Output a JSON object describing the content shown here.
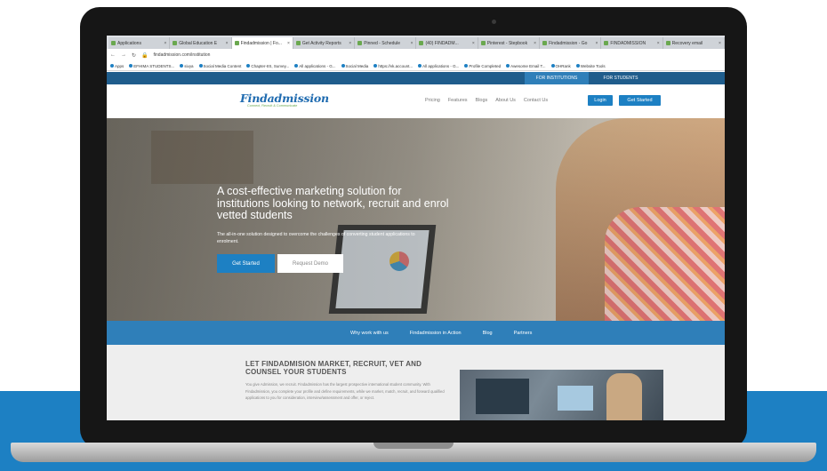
{
  "browser": {
    "tabs": [
      {
        "label": "Applications"
      },
      {
        "label": "Global Education E"
      },
      {
        "label": "Findadmission | Fo..."
      },
      {
        "label": "Get Activity Reports"
      },
      {
        "label": "Pinned - Schedule"
      },
      {
        "label": "(40) FINDADM..."
      },
      {
        "label": "Pinterest - Stepbook"
      },
      {
        "label": "Findadmission - Go"
      },
      {
        "label": "FINDADMISSION"
      },
      {
        "label": "Recovery email"
      }
    ],
    "url": "findadmission.com/institution",
    "bookmarks": [
      "Apps",
      "EFHIMA STUDENTS...",
      "sivya",
      "Social Media Content",
      "Chapter-IIS, Survey...",
      "All applications - G...",
      "Social Media",
      "https://vk.account...",
      "All applications - G...",
      "Profile Completed",
      "Awesome Email T...",
      "OHRank",
      "Website Tools"
    ]
  },
  "site": {
    "switch_institution": "FOR INSTITUTIONS",
    "switch_student": "FOR STUDENTS",
    "logo_text": "Findadmission",
    "logo_tagline": "Connect, Recruit & Communicate",
    "nav": [
      "Pricing",
      "Features",
      "Blogs",
      "About Us",
      "Contact Us"
    ],
    "login_label": "Login",
    "get_started_label": "Get Started",
    "hero_title": "A cost-effective marketing solution for institutions looking to network, recruit and enrol vetted students",
    "hero_subtitle": "The all-in-one solution designed to overcome the challenges of converting student applications to enrolment.",
    "hero_get_started": "Get Started",
    "hero_request_demo": "Request Demo",
    "subnav": [
      "Why work with us",
      "Findadmission in Action",
      "Blog",
      "Partners"
    ],
    "section_title": "LET FINDADMISION MARKET, RECRUIT, VET AND COUNSEL YOUR STUDENTS",
    "section_body": "You give Admission, we recruit. Findadmission has the largest prospective international student community. With Findadmission, you complete your profile and define requirements, while we market, match, recruit, and forward qualified applications to you for consideration, interview/assessment and offer, or reject."
  },
  "colors": {
    "brand_blue": "#1d80c3",
    "dark_nav": "#1f5d8c",
    "logo_green": "#6aa84f"
  }
}
